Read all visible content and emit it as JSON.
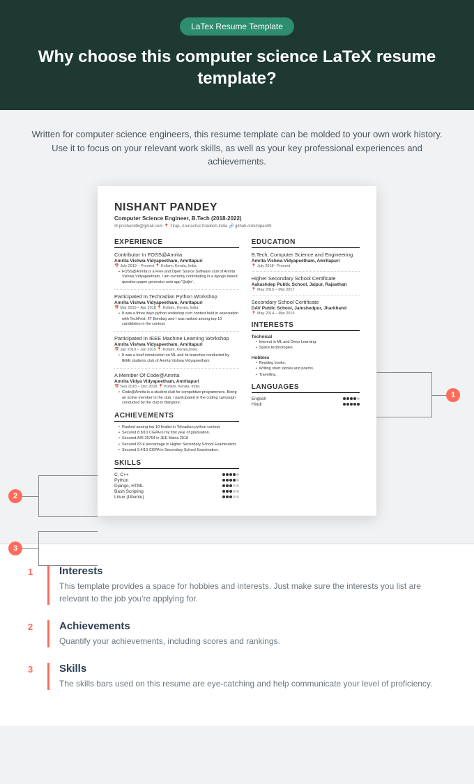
{
  "header": {
    "badge": "LaTex Resume Template",
    "title": "Why choose this computer science LaTeX resume template?"
  },
  "intro": "Written for computer science engineers, this resume template can be molded to your own work history. Use it to focus on your relevant work skills, as well as your key professional experiences and achievements.",
  "resume": {
    "name": "NISHANT PANDEY",
    "subtitle": "Computer Science Engineer, B.Tech (2018-2022)",
    "contact": "✉ pnishant46@gmail.com    📍 Tirap, Arunachal Pradesh,India    🔗 github.com/nipan09",
    "experience_hdr": "EXPERIENCE",
    "exp": [
      {
        "title": "Contributor In FOSS@Amrita",
        "sub": "Amrita Vishwa Vidyapeetham, Amritapuri",
        "date": "July 2019 – Present",
        "loc": "Kollam, Kerala, India",
        "b1": "FOSS@Amrita is a Free and Open Source Software club of Amrita Vishwa Vidyapeetham. I am currently contributing in a django based question paper generator web app 'Quijin'."
      },
      {
        "title": "Participated In Techradian Python Workshop",
        "sub": "Amrita Vishwa Vidyapeetham, Amritapuri",
        "date": "Mar 2019 – Apr 2018",
        "loc": "Kollam, Kerala, India",
        "b1": "It was a three days python workshop cum contest held in association with TechFest, IIT Bombay and I was ranked among top 10 candidates in the contest."
      },
      {
        "title": "Participated In IEEE Machine Learning Workshop",
        "sub": "Amrita Vishwa Vidyapeetham, Amritapuri",
        "date": "Jan 2019 – Jan 2019",
        "loc": "Kollam, Kerala,India",
        "b1": "It was a brief introduction on ML and its branches conducted by IEEE students club of Amrita Vishwa Vidyapeetham."
      },
      {
        "title": "A Member Of Code@Amrita",
        "sub": "Amrita Vidya Vidyapeetham, Amritapuri",
        "date": "Sep 2018 – Dec 2018",
        "loc": "Kollam, Kerala, India",
        "b1": "Code@Amrita is a student club for competitive programmers. Being an active member in the club, I participated in the coding campaign conducted by the club in Banglore."
      }
    ],
    "achievements_hdr": "ACHIEVEMENTS",
    "ach": [
      "Ranked among top 10 finalist in Tehradian python contest.",
      "Secured 8.8/10 CGPA in my first year of graduation.",
      "Secured AIR 25764 in JEE Mains 2018",
      "Secured 83.4 percentage in Higher Secondary School Examination.",
      "Secured 9.4/10 CGPA in Secondary School Examination."
    ],
    "skills_hdr": "SKILLS",
    "skills": [
      {
        "name": "C, C++",
        "level": 4
      },
      {
        "name": "Python",
        "level": 4
      },
      {
        "name": "Django, HTML",
        "level": 3
      },
      {
        "name": "Bash Scripting",
        "level": 3
      },
      {
        "name": "Linux (Ubuntu)",
        "level": 3
      }
    ],
    "education_hdr": "EDUCATION",
    "edu": [
      {
        "title": "B.Tech, Computer Science and Engineering",
        "sub": "Amrita Vishwa Vidyapeetham, Amritapuri",
        "date": "July 2018– Present"
      },
      {
        "title": "Higher Secondary School Certificate",
        "sub": "Aakashdep Public School, Jaipur, Rajasthan",
        "date": "May 2015 – Mar 2017"
      },
      {
        "title": "Secondary School Certificate",
        "sub": "DAV Public School, Jamshedpur, Jharkhand",
        "date": "May 2014 – Mar 2015"
      }
    ],
    "interests_hdr": "INTERESTS",
    "int_tech_hdr": "Technical",
    "int_tech": [
      "Interest in ML and Deep Learning.",
      "Space technologies."
    ],
    "int_hob_hdr": "Hobbies",
    "int_hob": [
      "Reading books.",
      "Writing short stories and poems.",
      "Travelling."
    ],
    "languages_hdr": "LANGUAGES",
    "langs": [
      {
        "name": "English",
        "level": 4
      },
      {
        "name": "Hindi",
        "level": 5
      }
    ]
  },
  "callouts": {
    "c1": "1",
    "c2": "2",
    "c3": "3"
  },
  "features": [
    {
      "num": "1",
      "title": "Interests",
      "desc": "This template provides a space for hobbies and interests. Just make sure the interests you list are relevant to the job you're applying for."
    },
    {
      "num": "2",
      "title": "Achievements",
      "desc": "Quantify your achievements, including scores and rankings."
    },
    {
      "num": "3",
      "title": "Skills",
      "desc": "The skills bars used on this resume are eye-catching and help communicate your level of proficiency."
    }
  ]
}
